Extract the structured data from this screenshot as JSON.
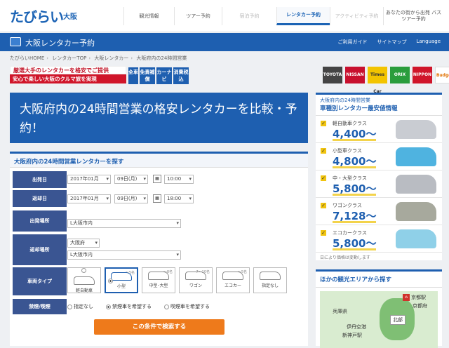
{
  "header": {
    "logo": "たびらい",
    "region": "大阪",
    "nav": [
      {
        "label": "観光情報"
      },
      {
        "label": "ツアー予約"
      },
      {
        "label": "宿泊予約"
      },
      {
        "label": "レンタカー予約"
      },
      {
        "label": "アクティビティ予約"
      },
      {
        "label": "あなたの街から出発 バスツアー予約"
      }
    ]
  },
  "bar": {
    "title": "大阪レンタカー予約",
    "guide": "ご利用ガイド",
    "sitemap": "サイトマップ",
    "language": "Language"
  },
  "breadcrumb": [
    "たびらいHOME",
    "レンタカーTOP",
    "大阪レンタカー",
    "大阪府内の24時間営業"
  ],
  "promo": {
    "line1": "厳選大手のレンタカーを格安でご提供",
    "line2": "安心で楽しい大阪のクルマ旅を実現"
  },
  "badges": [
    "全車",
    "免責補償",
    "カーナビ",
    "消費税込"
  ],
  "brands": [
    "TOYOTA",
    "NISSAN",
    "Times Car",
    "ORIX",
    "NIPPON",
    "Budget"
  ],
  "hero": "大阪府内の24時間営業の格安レンタカーを比較・予約！",
  "form": {
    "title": "大阪府内の24時間営業レンタカーを探す",
    "depart": {
      "label": "出発日",
      "month": "2017年01月",
      "day": "09日(月)",
      "time": "10:00"
    },
    "return": {
      "label": "返却日",
      "month": "2017年01月",
      "day": "09日(月)",
      "time": "18:00"
    },
    "depart_place": {
      "label": "出発場所",
      "value": "L大阪市内"
    },
    "return_place": {
      "label": "返却場所",
      "pref": "大阪府",
      "value": "L大阪市内"
    },
    "car_type": {
      "label": "車両タイプ",
      "options": [
        {
          "name": "軽自動車",
          "size": ""
        },
        {
          "name": "小型",
          "size": "〜5名"
        },
        {
          "name": "中型･大型",
          "size": "〜8名"
        },
        {
          "name": "ワゴン",
          "size": "7〜10名"
        },
        {
          "name": "エコカー",
          "size": "〜5名"
        },
        {
          "name": "指定なし",
          "size": ""
        }
      ]
    },
    "smoking": {
      "label": "禁煙/喫煙",
      "options": [
        "指定なし",
        "禁煙車を希望する",
        "喫煙車を希望する"
      ]
    },
    "submit": "この条件で検索する"
  },
  "side": {
    "sub": "大阪府内の24時間営業",
    "title": "車種別レンタカー最安値情報",
    "classes": [
      {
        "name": "軽自動車クラス",
        "price": "4,400〜"
      },
      {
        "name": "小型車クラス",
        "price": "4,800〜"
      },
      {
        "name": "中・大型クラス",
        "price": "5,800〜"
      },
      {
        "name": "ワゴンクラス",
        "price": "7,128〜"
      },
      {
        "name": "エコカークラス",
        "price": "5,800〜"
      }
    ],
    "note": "日により価格は変動します"
  },
  "area": {
    "title": "ほかの観光エリアから探す",
    "labels": [
      "京都駅",
      "兵庫県",
      "京都府",
      "北部",
      "伊丹空港",
      "新神戸駅"
    ]
  },
  "colors": {
    "brand_blue": "#1e5fb0",
    "label_navy": "#3a5592",
    "cta_orange": "#ee7a1b",
    "promo_red": "#d0152a"
  }
}
